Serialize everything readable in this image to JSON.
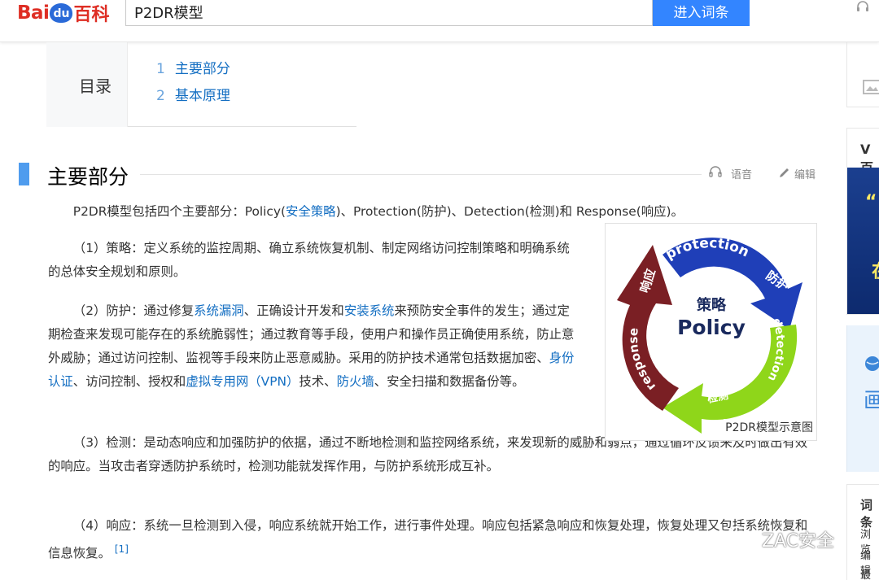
{
  "header": {
    "logo_text_1": "Bai",
    "logo_paw": "du",
    "logo_text_2": "百科",
    "search_value": "P2DR模型",
    "search_button": "进入词条",
    "right_icon": "headphones-icon"
  },
  "toc": {
    "title": "目录",
    "items": [
      {
        "num": "1",
        "label": "主要部分"
      },
      {
        "num": "2",
        "label": "基本原理"
      }
    ]
  },
  "section": {
    "title": "主要部分",
    "actions": [
      {
        "icon": "headphones-icon",
        "label": "语音"
      },
      {
        "icon": "pencil-icon",
        "label": "编辑"
      }
    ]
  },
  "content": {
    "intro": {
      "t1": "P2DR模型包括四个主要部分：Policy(",
      "link": "安全策略",
      "t2": ")、Protection(防护)、Detection(检测)和 Response(响应)。"
    },
    "p1": "（1）策略：定义系统的监控周期、确立系统恢复机制、制定网络访问控制策略和明确系统的总体安全规划和原则。",
    "p2": {
      "t1": "（2）防护：通过修复",
      "link1": "系统漏洞",
      "t2": "、正确设计开发和",
      "link2": "安装系统",
      "t3": "来预防安全事件的发生；通过定期检查来发现可能存在的系统脆弱性；通过教育等手段，使用户和操作员正确使用系统，防止意外威胁；通过访问控制、监视等手段来防止恶意威胁。采用的防护技术通常包括数据加密、",
      "link3": "身份认证",
      "t4": "、访问控制、授权和",
      "link4": "虚拟专用网（VPN）",
      "t5": "技术、",
      "link5": "防火墙",
      "t6": "、安全扫描和数据备份等。"
    },
    "p3": "（3）检测：是动态响应和加强防护的依据，通过不断地检测和监控网络系统，来发现新的威胁和弱点，通过循环反馈来及时做出有效的响应。当攻击者穿透防护系统时，检测功能就发挥作用，与防护系统形成互补。",
    "p4": "（4）响应：系统一旦检测到入侵，响应系统就开始工作，进行事件处理。响应包括紧急响应和恢复处理，恢复处理又包括系统恢复和信息恢复。",
    "p4_cite": "[1]"
  },
  "figure": {
    "center_cn": "策略",
    "center_en": "Policy",
    "arrow_top_en": "protection",
    "arrow_top_cn": "防护",
    "arrow_right_en": "detection",
    "arrow_bottom_cn": "检测",
    "arrow_left_en": "response",
    "arrow_left_cn": "响应",
    "caption": "P2DR模型示意图",
    "colors": {
      "protection": "#1f3fb8",
      "detection": "#8fd61a",
      "response": "#7a1f24"
    }
  },
  "watermark": {
    "icon": "wechat-icon",
    "text": "ZAC安全"
  },
  "sidebar": {
    "album_icon": "image-album-icon",
    "v_title": "V百",
    "v_banner_1": "“",
    "v_banner_2": "在",
    "promo_icon": "globe-icon",
    "promo_text": "画",
    "card_title": "词条",
    "card_lines": [
      "浏览",
      "编辑",
      "最近"
    ]
  }
}
